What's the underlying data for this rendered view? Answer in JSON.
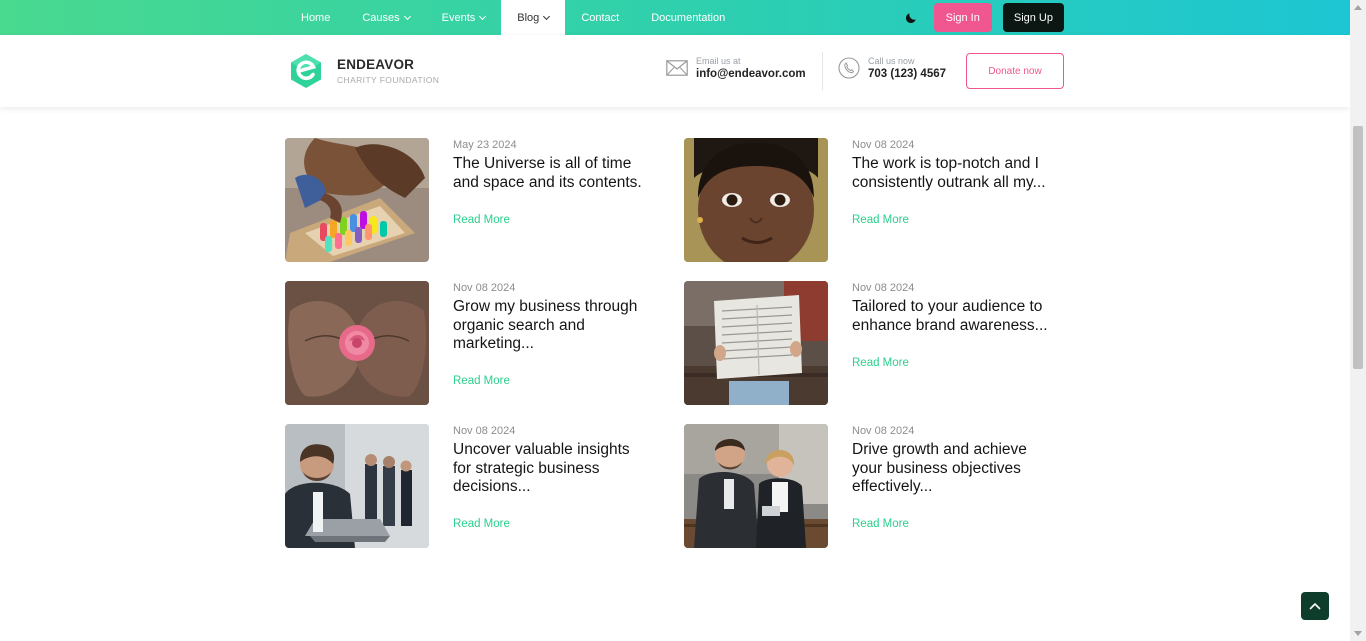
{
  "nav": {
    "items": [
      {
        "label": "Home",
        "dropdown": false,
        "active": false
      },
      {
        "label": "Causes",
        "dropdown": true,
        "active": false
      },
      {
        "label": "Events",
        "dropdown": true,
        "active": false
      },
      {
        "label": "Blog",
        "dropdown": true,
        "active": true
      },
      {
        "label": "Contact",
        "dropdown": false,
        "active": false
      },
      {
        "label": "Documentation",
        "dropdown": false,
        "active": false
      }
    ],
    "signin_label": "Sign In",
    "signup_label": "Sign Up",
    "theme_icon": "moon-icon"
  },
  "header": {
    "brand_name": "ENDEAVOR",
    "brand_sub": "CHARITY FOUNDATION",
    "email_label": "Email us at",
    "email_value": "info@endeavor.com",
    "phone_label": "Call us now",
    "phone_value": "703 (123) 4567",
    "donate_label": "Donate now"
  },
  "posts": [
    {
      "date": "May 23 2024",
      "title_lines": [
        "The Universe is all of time",
        "and space and its contents."
      ],
      "read_more": "Read More",
      "image": "crayons-photo"
    },
    {
      "date": "Nov 08 2024",
      "title_lines": [
        "The work is top-notch and I",
        "consistently outrank all my..."
      ],
      "read_more": "Read More",
      "image": "child-portrait-photo"
    },
    {
      "date": "Nov 08 2024",
      "title_lines": [
        "Grow my business through",
        "organic search and",
        "marketing..."
      ],
      "read_more": "Read More",
      "image": "rose-in-hands-photo"
    },
    {
      "date": "Nov 08 2024",
      "title_lines": [
        "Tailored to your audience to",
        "enhance brand awareness..."
      ],
      "read_more": "Read More",
      "image": "newspaper-reader-photo"
    },
    {
      "date": "Nov 08 2024",
      "title_lines": [
        "Uncover valuable insights",
        "for strategic business",
        "decisions..."
      ],
      "read_more": "Read More",
      "image": "businessman-laptop-photo"
    },
    {
      "date": "Nov 08 2024",
      "title_lines": [
        "Drive growth and achieve",
        "your business objectives",
        "effectively..."
      ],
      "read_more": "Read More",
      "image": "business-meeting-photo"
    }
  ],
  "colors": {
    "accent_green": "#2ccf8d",
    "pink": "#f0568f",
    "dark": "#0c1713",
    "to_top_bg": "#0f3d2c"
  }
}
